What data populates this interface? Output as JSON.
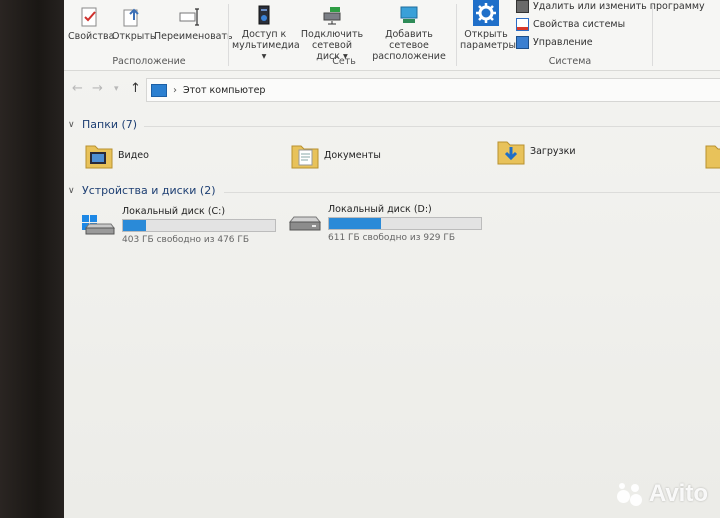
{
  "ribbon": {
    "buttons": [
      {
        "label": "Свойства"
      },
      {
        "label": "Открыть"
      },
      {
        "label": "Переименовать"
      },
      {
        "label": "Доступ к мультимедиа ▾"
      },
      {
        "label": "Подключить сетевой диск ▾"
      },
      {
        "label": "Добавить сетевое расположение"
      },
      {
        "label": "Открыть параметры"
      }
    ],
    "small_items": [
      {
        "label": "Удалить или изменить программу"
      },
      {
        "label": "Свойства системы"
      },
      {
        "label": "Управление"
      }
    ],
    "groups": {
      "location": "Расположение",
      "network": "Сеть",
      "system": "Система"
    }
  },
  "address": {
    "crumb": "Этот компьютер"
  },
  "folders_section": {
    "title": "Папки (7)"
  },
  "folders": [
    {
      "label": "Видео"
    },
    {
      "label": "Документы"
    },
    {
      "label": "Загрузки"
    }
  ],
  "devices_section": {
    "title": "Устройства и диски (2)"
  },
  "drives": [
    {
      "name": "Локальный диск (C:)",
      "free": "403 ГБ свободно из 476 ГБ",
      "used_fraction": 0.15
    },
    {
      "name": "Локальный диск (D:)",
      "free": "611 ГБ свободно из 929 ГБ",
      "used_fraction": 0.34
    }
  ],
  "watermark": {
    "text": "Avito"
  },
  "colors": {
    "accent": "#2a8ad8",
    "section": "#1e3f73"
  }
}
